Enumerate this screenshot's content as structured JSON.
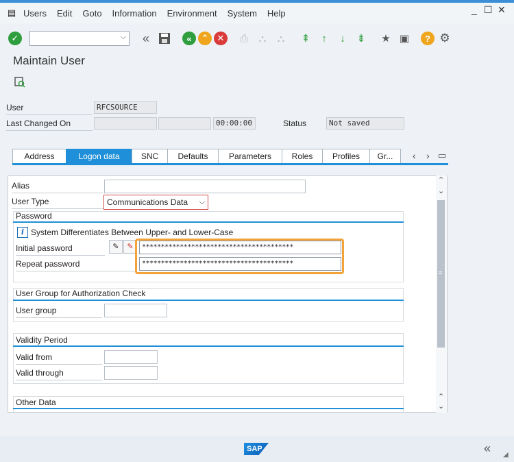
{
  "menubar": {
    "items": [
      "Users",
      "Edit",
      "Goto",
      "Information",
      "Environment",
      "System",
      "Help"
    ]
  },
  "window": {
    "minimize": "_",
    "restore": "☐",
    "close": "✕"
  },
  "toolbar": {
    "command_value": ""
  },
  "page": {
    "title": "Maintain User"
  },
  "header": {
    "user_label": "User",
    "user_value": "RFCSOURCE",
    "last_changed_label": "Last Changed On",
    "last_changed_time": "00:00:00",
    "status_label": "Status",
    "status_value": "Not saved"
  },
  "tabs": [
    "Address",
    "Logon data",
    "SNC",
    "Defaults",
    "Parameters",
    "Roles",
    "Profiles",
    "Gr..."
  ],
  "active_tab": "Logon data",
  "logon": {
    "alias_label": "Alias",
    "alias_value": "",
    "user_type_label": "User Type",
    "user_type_value": "Communications Data"
  },
  "password": {
    "section_title": "Password",
    "info_text": "System Differentiates Between Upper- and Lower-Case",
    "initial_label": "Initial password",
    "initial_value": "****************************************",
    "repeat_label": "Repeat password",
    "repeat_value": "****************************************"
  },
  "auth_group": {
    "section_title": "User Group for Authorization Check",
    "group_label": "User group",
    "group_value": ""
  },
  "validity": {
    "section_title": "Validity Period",
    "from_label": "Valid from",
    "from_value": "",
    "through_label": "Valid through",
    "through_value": ""
  },
  "other": {
    "section_title": "Other Data"
  },
  "footer": {
    "logo_text": "SAP"
  },
  "colors": {
    "accent": "#1e8fd8",
    "highlight": "#f2a33a",
    "menu_bar": "#3a8fd6"
  }
}
